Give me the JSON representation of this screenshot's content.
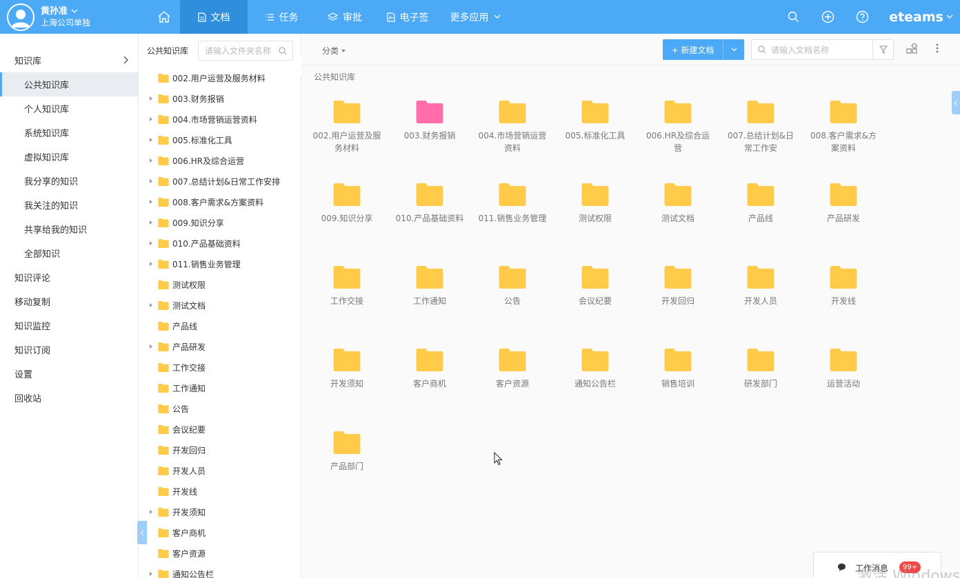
{
  "colors": {
    "accent": "#4ba9f5",
    "accent_dark": "#2f8fdc",
    "folder_yellow": "#ffcb48",
    "folder_pink": "#ff6eaa"
  },
  "user": {
    "name": "黄孙准",
    "company": "上海公司单独"
  },
  "nav": {
    "items": [
      {
        "label": "文档",
        "icon": "document-icon",
        "active": true
      },
      {
        "label": "任务",
        "icon": "list-icon",
        "active": false
      },
      {
        "label": "审批",
        "icon": "layers-icon",
        "active": false
      },
      {
        "label": "电子签",
        "icon": "signature-icon",
        "active": false
      },
      {
        "label": "更多应用",
        "icon": "chevron-down-icon",
        "active": false
      }
    ]
  },
  "brand": "eteams",
  "sidebar": {
    "items": [
      {
        "label": "知识库",
        "level": 0,
        "has_arrow": true
      },
      {
        "label": "公共知识库",
        "level": 1,
        "active": true
      },
      {
        "label": "个人知识库",
        "level": 1
      },
      {
        "label": "系统知识库",
        "level": 1
      },
      {
        "label": "虚拟知识库",
        "level": 1
      },
      {
        "label": "我分享的知识",
        "level": 1
      },
      {
        "label": "我关注的知识",
        "level": 1
      },
      {
        "label": "共享给我的知识",
        "level": 1
      },
      {
        "label": "全部知识",
        "level": 1
      },
      {
        "label": "知识评论",
        "level": 0
      },
      {
        "label": "移动复制",
        "level": 0
      },
      {
        "label": "知识监控",
        "level": 0
      },
      {
        "label": "知识订阅",
        "level": 0
      },
      {
        "label": "设置",
        "level": 0
      },
      {
        "label": "回收站",
        "level": 0
      }
    ]
  },
  "tree": {
    "title": "公共知识库",
    "search_placeholder": "请输入文件夹名称",
    "items": [
      {
        "label": "002.用户运营及服务材料",
        "expandable": false
      },
      {
        "label": "003.财务报销",
        "expandable": true
      },
      {
        "label": "004.市场营销运营资料",
        "expandable": true
      },
      {
        "label": "005.标准化工具",
        "expandable": true
      },
      {
        "label": "006.HR及综合运营",
        "expandable": true
      },
      {
        "label": "007.总结计划&日常工作安排",
        "expandable": true
      },
      {
        "label": "008.客户需求&方案资料",
        "expandable": true
      },
      {
        "label": "009.知识分享",
        "expandable": true
      },
      {
        "label": "010.产品基础资料",
        "expandable": true
      },
      {
        "label": "011.销售业务管理",
        "expandable": true
      },
      {
        "label": "测试权限",
        "expandable": false
      },
      {
        "label": "测试文档",
        "expandable": true
      },
      {
        "label": "产品线",
        "expandable": false
      },
      {
        "label": "产品研发",
        "expandable": true
      },
      {
        "label": "工作交接",
        "expandable": false
      },
      {
        "label": "工作通知",
        "expandable": false
      },
      {
        "label": "公告",
        "expandable": false
      },
      {
        "label": "会议纪要",
        "expandable": false
      },
      {
        "label": "开发回归",
        "expandable": false
      },
      {
        "label": "开发人员",
        "expandable": false
      },
      {
        "label": "开发线",
        "expandable": false
      },
      {
        "label": "开发须知",
        "expandable": true
      },
      {
        "label": "客户商机",
        "expandable": false
      },
      {
        "label": "客户资源",
        "expandable": false
      },
      {
        "label": "通知公告栏",
        "expandable": true
      }
    ]
  },
  "toolbar": {
    "category_label": "分类",
    "new_doc_label": "+ 新建文档",
    "search_placeholder": "请输入文档名称"
  },
  "breadcrumb": "公共知识库",
  "folders": [
    {
      "label": "002.用户运营及服务材料",
      "color": "yellow"
    },
    {
      "label": "003.财务报销",
      "color": "pink"
    },
    {
      "label": "004.市场营销运营资料",
      "color": "yellow"
    },
    {
      "label": "005.标准化工具",
      "color": "yellow"
    },
    {
      "label": "006.HR及综合运营",
      "color": "yellow"
    },
    {
      "label": "007.总结计划&日常工作安",
      "color": "yellow"
    },
    {
      "label": "008.客户需求&方案资料",
      "color": "yellow"
    },
    {
      "label": "009.知识分享",
      "color": "yellow"
    },
    {
      "label": "010.产品基础资料",
      "color": "yellow"
    },
    {
      "label": "011.销售业务管理",
      "color": "yellow"
    },
    {
      "label": "测试权限",
      "color": "yellow"
    },
    {
      "label": "测试文档",
      "color": "yellow"
    },
    {
      "label": "产品线",
      "color": "yellow"
    },
    {
      "label": "产品研发",
      "color": "yellow"
    },
    {
      "label": "工作交接",
      "color": "yellow"
    },
    {
      "label": "工作通知",
      "color": "yellow"
    },
    {
      "label": "公告",
      "color": "yellow"
    },
    {
      "label": "会议纪要",
      "color": "yellow"
    },
    {
      "label": "开发回归",
      "color": "yellow"
    },
    {
      "label": "开发人员",
      "color": "yellow"
    },
    {
      "label": "开发线",
      "color": "yellow"
    },
    {
      "label": "开发须知",
      "color": "yellow"
    },
    {
      "label": "客户商机",
      "color": "yellow"
    },
    {
      "label": "客户资源",
      "color": "yellow"
    },
    {
      "label": "通知公告栏",
      "color": "yellow"
    },
    {
      "label": "销售培训",
      "color": "yellow"
    },
    {
      "label": "研发部门",
      "color": "yellow"
    },
    {
      "label": "运营活动",
      "color": "yellow"
    },
    {
      "label": "产品部门",
      "color": "yellow"
    }
  ],
  "messages": {
    "label": "工作消息",
    "badge": "99+"
  },
  "watermark": "激活 Windows"
}
